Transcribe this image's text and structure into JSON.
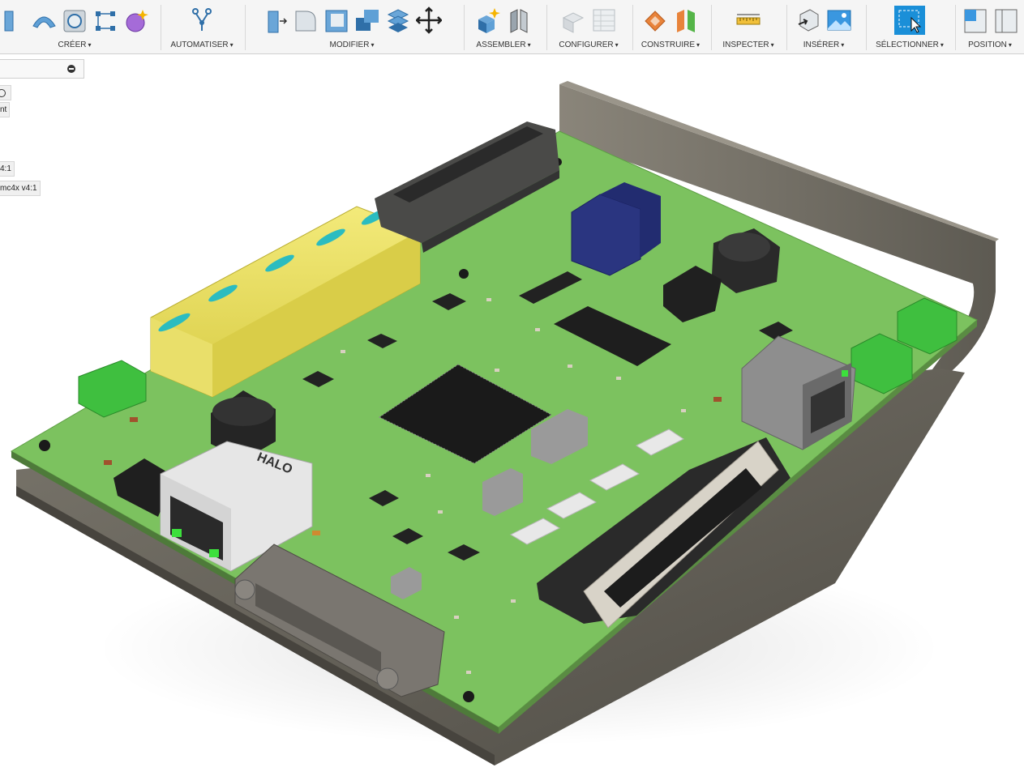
{
  "toolbar": {
    "groups": [
      {
        "label": "CRÉER"
      },
      {
        "label": "AUTOMATISER"
      },
      {
        "label": "MODIFIER"
      },
      {
        "label": "ASSEMBLER"
      },
      {
        "label": "CONFIGURER"
      },
      {
        "label": "CONSTRUIRE"
      },
      {
        "label": "INSPECTER"
      },
      {
        "label": "INSÉRER"
      },
      {
        "label": "SÉLECTIONNER"
      },
      {
        "label": "POSITION"
      }
    ],
    "caret": "▾"
  },
  "browser": {
    "items": [
      {
        "label": "nt"
      },
      {
        "label": "4:1"
      },
      {
        "label": "mc4x v4:1"
      }
    ]
  },
  "model": {
    "connector_brand": "HALO",
    "accent": "#1a8fd8",
    "pcb_color": "#7cc25f",
    "case_color": "#6e6a60"
  }
}
